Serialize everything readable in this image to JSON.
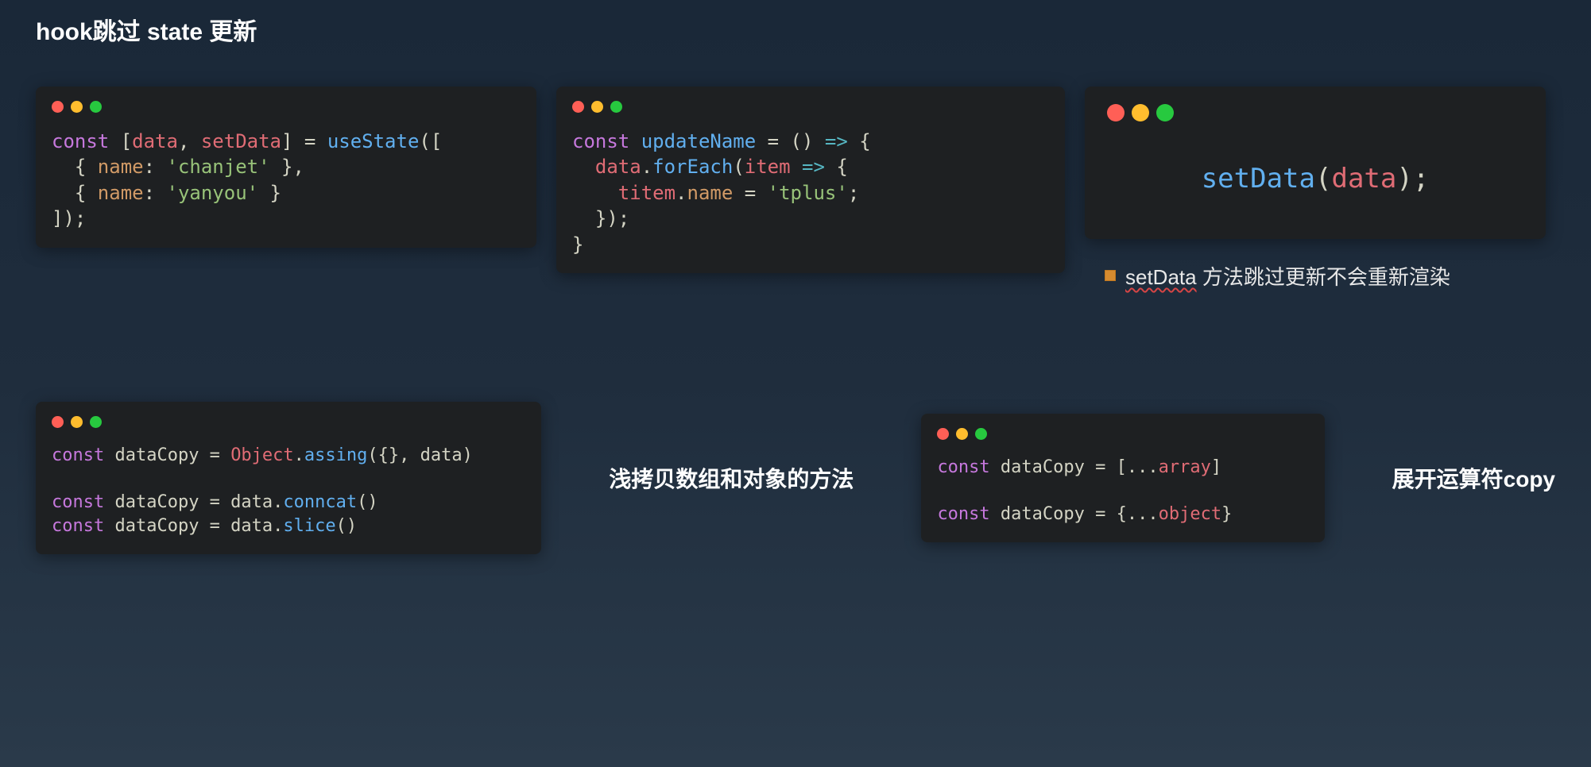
{
  "title": "hook跳过 state 更新",
  "code": {
    "block1": {
      "l1a": "const",
      "l1b": " [",
      "l1c": "data",
      "l1d": ", ",
      "l1e": "setData",
      "l1f": "] = ",
      "l1g": "useState",
      "l1h": "([",
      "l2a": "  { ",
      "l2b": "name",
      "l2c": ": ",
      "l2d": "'chanjet'",
      "l2e": " },",
      "l3a": "  { ",
      "l3b": "name",
      "l3c": ": ",
      "l3d": "'yanyou'",
      "l3e": " }",
      "l4a": "]);"
    },
    "block2": {
      "l1a": "const",
      "l1b": " ",
      "l1c": "updateName",
      "l1d": " = () ",
      "l1e": "=>",
      "l1f": " {",
      "l2a": "  ",
      "l2b": "data",
      "l2c": ".",
      "l2d": "forEach",
      "l2e": "(",
      "l2f": "item",
      "l2g": " ",
      "l2h": "=>",
      "l2i": " {",
      "l3a": "    ",
      "l3b": "titem",
      "l3c": ".",
      "l3d": "name",
      "l3e": " = ",
      "l3f": "'tplus'",
      "l3g": ";",
      "l4a": "  });",
      "l5a": "}"
    },
    "block3": {
      "l1a": "setData",
      "l1b": "(",
      "l1c": "data",
      "l1d": ");"
    },
    "block4": {
      "l1a": "const",
      "l1b": " dataCopy = ",
      "l1c": "Object",
      "l1d": ".",
      "l1e": "assing",
      "l1f": "({}, data)",
      "l2_blank": " ",
      "l3a": "const",
      "l3b": " dataCopy = data.",
      "l3c": "conncat",
      "l3d": "()",
      "l4a": "const",
      "l4b": " dataCopy = data.",
      "l4c": "slice",
      "l4d": "()"
    },
    "block5": {
      "l1a": "const",
      "l1b": " dataCopy = [...",
      "l1c": "array",
      "l1d": "]",
      "l2_blank": " ",
      "l3a": "const",
      "l3b": " dataCopy = {...",
      "l3c": "object",
      "l3d": "}"
    }
  },
  "note": {
    "underlined": "setData",
    "rest": " 方法跳过更新不会重新渲染"
  },
  "labels": {
    "copy_methods": "浅拷贝数组和对象的方法",
    "spread": "展开运算符copy"
  }
}
